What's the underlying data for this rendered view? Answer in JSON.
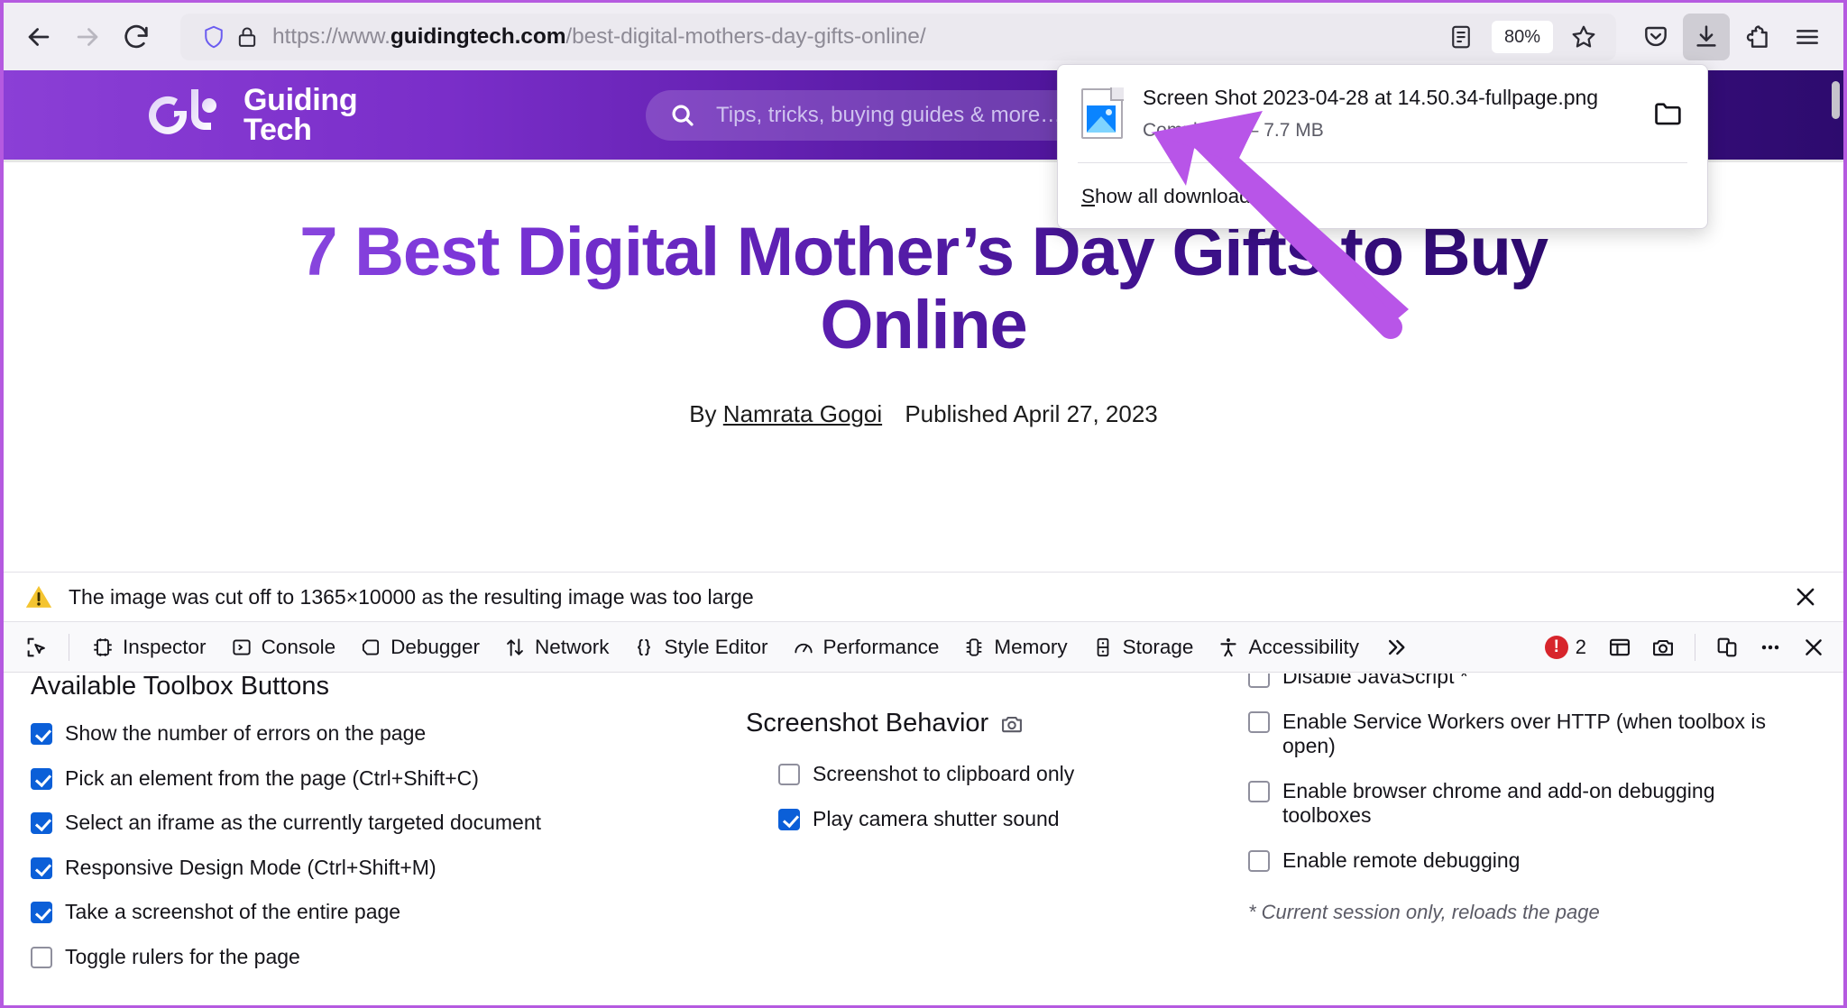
{
  "browser": {
    "nav": {
      "back_icon": "back-arrow-icon",
      "forward_icon": "forward-arrow-icon",
      "reload_icon": "reload-icon"
    },
    "urlbar": {
      "shield_icon": "shield-icon",
      "lock_icon": "padlock-icon",
      "url_prefix": "https://www.",
      "url_domain": "guidingtech.com",
      "url_path": "/best-digital-mothers-day-gifts-online/",
      "reader_icon": "reader-mode-icon",
      "zoom_level": "80%",
      "bookmark_icon": "star-icon"
    },
    "toolbar_right": {
      "pocket_icon": "pocket-icon",
      "downloads_icon": "downloads-arrow-icon",
      "extensions_icon": "extensions-puzzle-icon",
      "menu_icon": "hamburger-menu-icon"
    },
    "downloads_panel": {
      "file_icon": "image-file-icon",
      "file_name": "Screen Shot 2023-04-28 at 14.50.34-fullpage.png",
      "file_status": "Completed — 7.7 MB",
      "folder_icon": "folder-icon",
      "show_all_label": "Show all downloads",
      "show_all_accesskey": "S",
      "show_all_rest": "how all downloads"
    }
  },
  "site": {
    "logo_text_line1": "Guiding",
    "logo_text_line2": "Tech",
    "logo_icon": "guiding-tech-logo",
    "search": {
      "icon": "search-icon",
      "placeholder": "Tips, tricks, buying guides & more…"
    }
  },
  "article": {
    "title": "7 Best Digital Mother’s Day Gifts to Buy Online",
    "byline_prefix": "By",
    "author": "Namrata Gogoi",
    "published": "Published April 27, 2023"
  },
  "warning": {
    "icon": "warning-triangle-icon",
    "message": "The image was cut off to 1365×10000 as the resulting image was too large",
    "close_icon": "close-icon"
  },
  "devtools": {
    "picker_icon": "element-picker-icon",
    "tabs": [
      {
        "label": "Inspector",
        "icon": "inspector-icon"
      },
      {
        "label": "Console",
        "icon": "console-icon"
      },
      {
        "label": "Debugger",
        "icon": "debugger-icon"
      },
      {
        "label": "Network",
        "icon": "network-icon"
      },
      {
        "label": "Style Editor",
        "icon": "style-editor-icon"
      },
      {
        "label": "Performance",
        "icon": "performance-icon"
      },
      {
        "label": "Memory",
        "icon": "memory-icon"
      },
      {
        "label": "Storage",
        "icon": "storage-icon"
      },
      {
        "label": "Accessibility",
        "icon": "accessibility-icon"
      }
    ],
    "overflow_icon": "chevron-double-right-icon",
    "error_count": "2",
    "error_icon": "error-badge-icon",
    "dock_icon": "dock-layout-icon",
    "camera_icon": "camera-icon",
    "responsive_icon": "responsive-design-mode-icon",
    "more_icon": "meatball-menu-icon",
    "close_icon": "close-icon",
    "settings": {
      "toolbox_buttons": {
        "title": "Available Toolbox Buttons",
        "options": [
          {
            "label": "Show the number of errors on the page",
            "checked": true
          },
          {
            "label": "Pick an element from the page (Ctrl+Shift+C)",
            "checked": true
          },
          {
            "label": "Select an iframe as the currently targeted document",
            "checked": true
          },
          {
            "label": "Responsive Design Mode (Ctrl+Shift+M)",
            "checked": true
          },
          {
            "label": "Take a screenshot of the entire page",
            "checked": true
          },
          {
            "label": "Toggle rulers for the page",
            "checked": false
          }
        ]
      },
      "screenshot_behavior": {
        "title": "Screenshot Behavior",
        "icon": "camera-icon",
        "options": [
          {
            "label": "Screenshot to clipboard only",
            "checked": false
          },
          {
            "label": "Play camera shutter sound",
            "checked": true
          }
        ]
      },
      "advanced": {
        "options": [
          {
            "label": "Disable JavaScript *",
            "checked": false
          },
          {
            "label": "Enable Service Workers over HTTP (when toolbox is open)",
            "checked": false
          },
          {
            "label": "Enable browser chrome and add-on debugging toolboxes",
            "checked": false
          },
          {
            "label": "Enable remote debugging",
            "checked": false
          }
        ],
        "footnote": "* Current session only, reloads the page"
      }
    }
  },
  "annotation": {
    "arrow_icon": "purple-pointer-arrow",
    "arrow_color": "#b855e8"
  },
  "colors": {
    "accent_purple": "#b55ae0",
    "site_purple_dark": "#2d0b6e",
    "checkbox_blue": "#0b5fd8",
    "error_red": "#d7252c",
    "warning_yellow": "#f4c430"
  }
}
